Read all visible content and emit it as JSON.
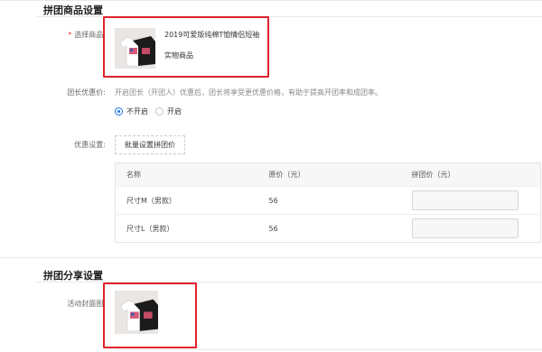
{
  "section_goods": {
    "title": "拼团商品设置"
  },
  "select_goods": {
    "required_mark": "*",
    "label": "选择商品:",
    "product_name": "2019可爱版纯棉T恤情侣短袖",
    "product_type": "实物商品"
  },
  "leader_discount": {
    "label": "团长优惠价:",
    "description": "开启团长（开团人）优惠后，团长将享受更优惠价格，有助于提高开团率和成团率。",
    "options": [
      {
        "label": "不开启",
        "selected": true
      },
      {
        "label": "开启",
        "selected": false
      }
    ]
  },
  "discount_setting": {
    "label": "优惠设置:",
    "batch_button": "批量设置拼团价"
  },
  "price_table": {
    "headers": [
      "名称",
      "原价（元）",
      "拼团价（元）"
    ],
    "rows": [
      {
        "name": "尺寸M（男款）",
        "original_price": "56"
      },
      {
        "name": "尺寸L（男款）",
        "original_price": "56"
      }
    ]
  },
  "section_share": {
    "title": "拼团分享设置"
  },
  "cover": {
    "label": "活动封面图:"
  },
  "colors": {
    "accent": "#1a73e8",
    "highlight_border": "#e0222b",
    "required": "#e33333"
  }
}
